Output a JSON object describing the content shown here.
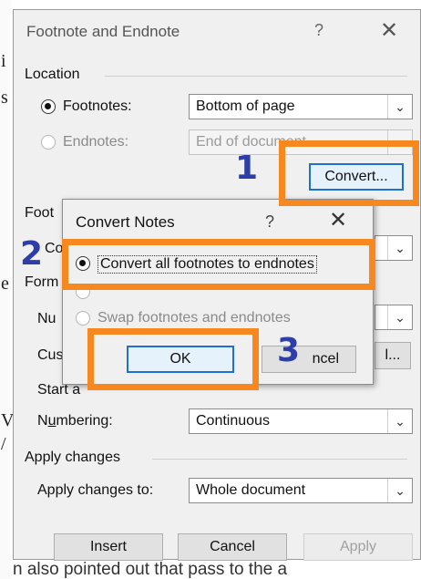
{
  "background": {
    "left_fragments": [
      "i",
      "s",
      "e",
      "l",
      "V",
      "/"
    ],
    "bottom_text": "n also pointed out that pass to the a"
  },
  "footnote_dialog": {
    "title": "Footnote and Endnote",
    "help": "?",
    "close": "✕",
    "location_section": "Location",
    "footnotes_label": "Footnotes:",
    "footnotes_value": "Bottom of page",
    "endnotes_label": "Endnotes:",
    "endnotes_value": "End of document",
    "convert_button": "Convert...",
    "footnote_layout_section_partial": "Foot",
    "columns_label_partial": "Co",
    "format_section_partial": "Form",
    "number_format_label_partial": "Nu",
    "custom_mark_label_partial": "Cus",
    "start_at_label_partial": "Start a",
    "symbol_button_partial": "l...",
    "numbering_label": "Numbering:",
    "numbering_value": "Continuous",
    "apply_section": "Apply changes",
    "apply_to_label": "Apply changes to:",
    "apply_to_value": "Whole document",
    "insert_button": "Insert",
    "cancel_button": "Cancel",
    "apply_button": "Apply"
  },
  "convert_dialog": {
    "title": "Convert Notes",
    "help": "?",
    "close": "✕",
    "options": [
      {
        "label": "Convert all footnotes to endnotes",
        "checked": true,
        "enabled": true
      },
      {
        "label": "",
        "checked": false,
        "enabled": false
      },
      {
        "label": "Swap footnotes and endnotes",
        "checked": false,
        "enabled": false
      }
    ],
    "ok_button": "OK",
    "cancel_button_partial": "ncel"
  },
  "annotations": {
    "step1": "1",
    "step2": "2",
    "step3": "3",
    "highlight_color": "#f7871f",
    "number_color": "#2d3ea8"
  },
  "icons": {
    "dropdown": "chevron-down-icon",
    "close": "close-icon",
    "help": "help-icon"
  }
}
